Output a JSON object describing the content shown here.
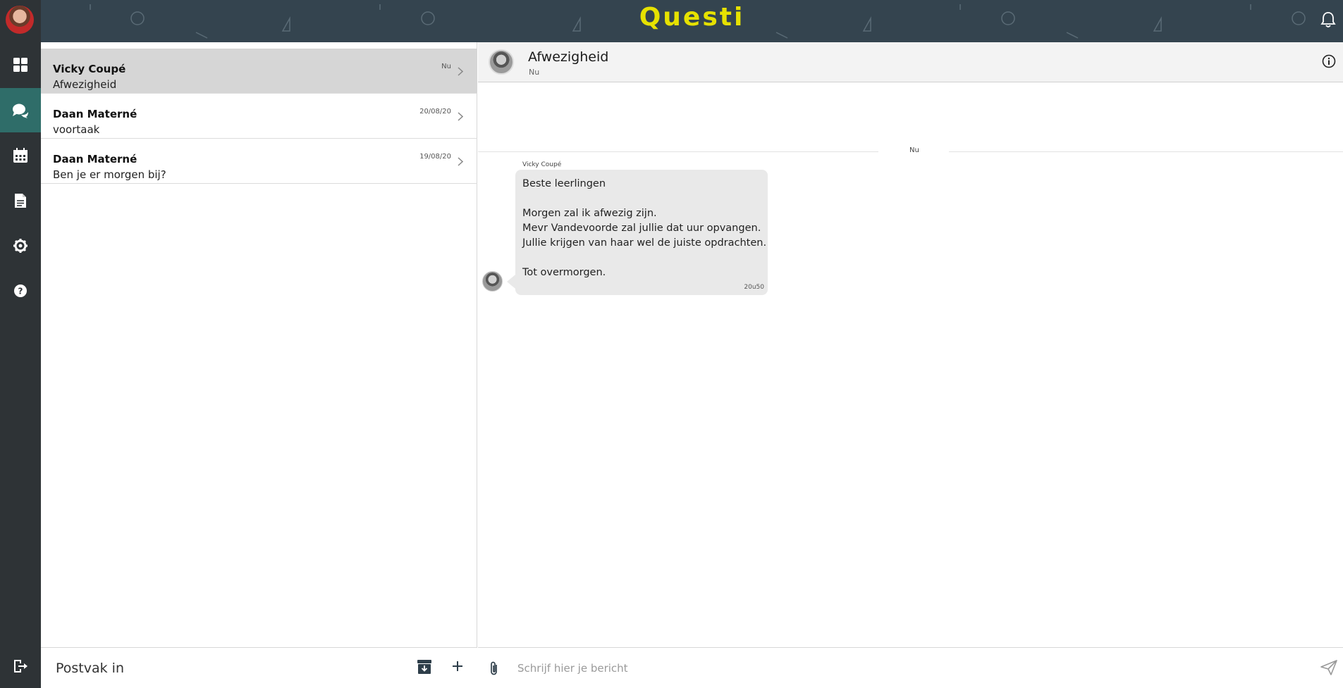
{
  "app": {
    "logo_text": "Questi"
  },
  "rail": {
    "items": [
      "dashboard",
      "messages",
      "calendar",
      "documents",
      "settings",
      "help",
      "logout"
    ]
  },
  "conversations": [
    {
      "name": "Vicky Coupé",
      "subject": "Afwezigheid",
      "date": "Nu",
      "selected": true
    },
    {
      "name": "Daan Materné",
      "subject": "voortaak",
      "date": "20/08/20",
      "selected": false
    },
    {
      "name": "Daan Materné",
      "subject": "Ben je er morgen bij?",
      "date": "19/08/20",
      "selected": false
    }
  ],
  "list_footer": {
    "title": "Postvak in"
  },
  "chat": {
    "subject": "Afwezigheid",
    "time": "Nu",
    "divider_label": "Nu",
    "message": {
      "sender": "Vicky Coupé",
      "lines": [
        "Beste leerlingen",
        "",
        "Morgen zal ik afwezig zijn.",
        "Mevr Vandevoorde zal jullie dat uur opvangen.",
        "Jullie krijgen van haar wel de juiste opdrachten.",
        "",
        "Tot overmorgen."
      ],
      "time": "20u50"
    },
    "composer_placeholder": "Schrijf hier je bericht"
  },
  "colors": {
    "rail": "#2e3336",
    "rail_active": "#2f6d69",
    "topbar": "#34444f",
    "logo": "#e6e100"
  }
}
